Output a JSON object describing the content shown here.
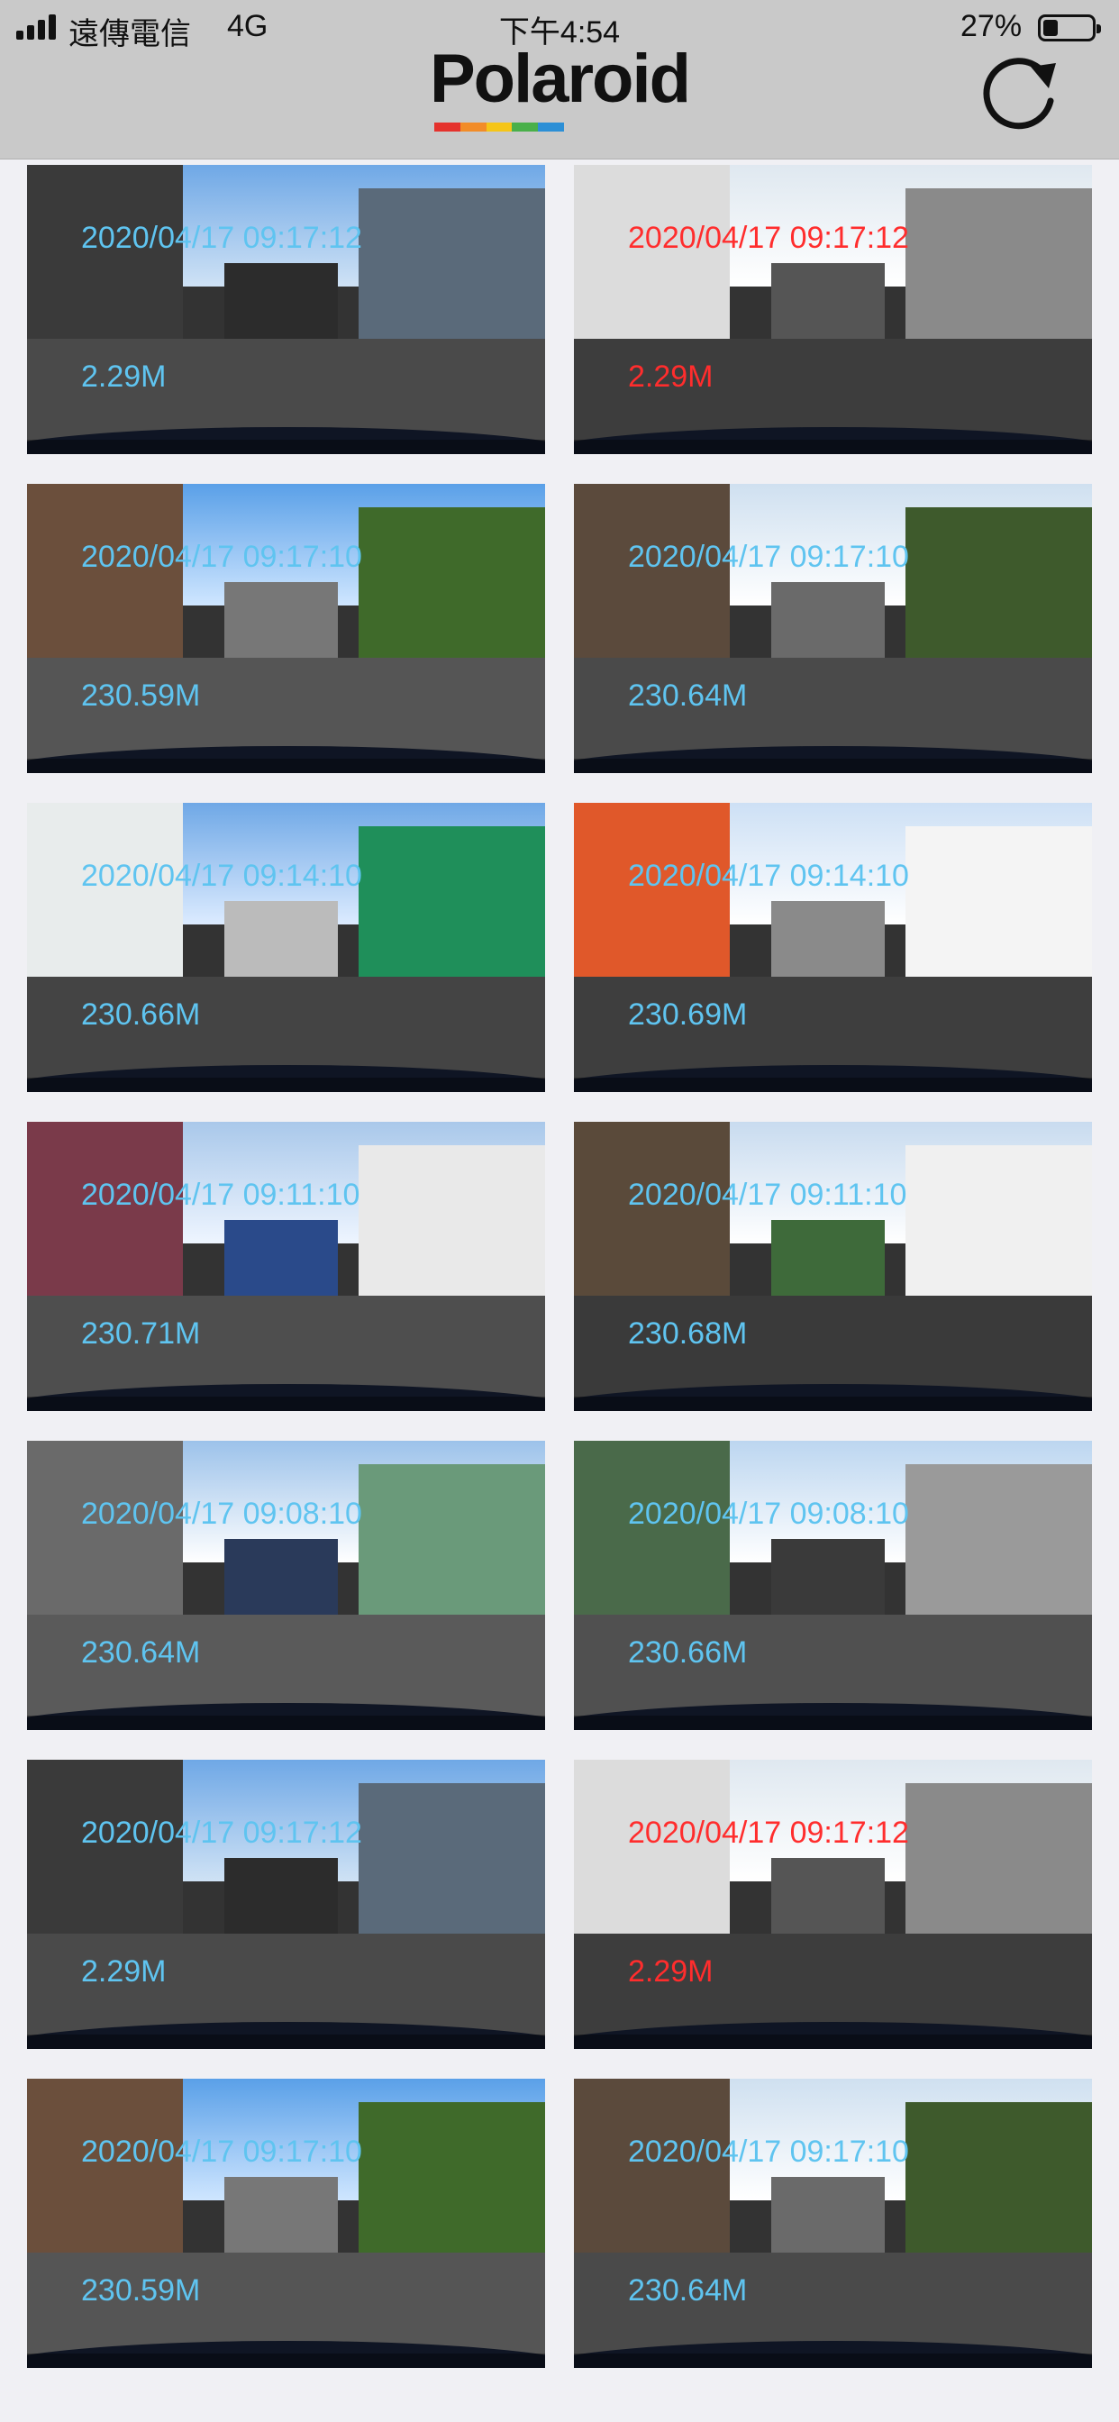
{
  "status_bar": {
    "carrier": "遠傳電信",
    "network": "4G",
    "time": "下午4:54",
    "battery": "27%"
  },
  "header": {
    "brand": "Polaroid",
    "stripe_colors": [
      "#e5322d",
      "#f28c28",
      "#f5c518",
      "#49b04a",
      "#2c8fd6"
    ],
    "refresh_icon": "refresh-icon"
  },
  "colors": {
    "header_bg": "#c9c9c9",
    "overlay_text_blue": "#5fc4f0",
    "overlay_text_red": "#ff2d2d",
    "page_bg": "#f0f0f4"
  },
  "videos": [
    {
      "timestamp": "2020/04/17 09:17:12",
      "size": "2.29M",
      "highlight": false
    },
    {
      "timestamp": "2020/04/17 09:17:12",
      "size": "2.29M",
      "highlight": true
    },
    {
      "timestamp": "2020/04/17 09:17:10",
      "size": "230.59M",
      "highlight": false
    },
    {
      "timestamp": "2020/04/17 09:17:10",
      "size": "230.64M",
      "highlight": false
    },
    {
      "timestamp": "2020/04/17 09:14:10",
      "size": "230.66M",
      "highlight": false
    },
    {
      "timestamp": "2020/04/17 09:14:10",
      "size": "230.69M",
      "highlight": false
    },
    {
      "timestamp": "2020/04/17 09:11:10",
      "size": "230.71M",
      "highlight": false
    },
    {
      "timestamp": "2020/04/17 09:11:10",
      "size": "230.68M",
      "highlight": false
    },
    {
      "timestamp": "2020/04/17 09:08:10",
      "size": "230.64M",
      "highlight": false
    },
    {
      "timestamp": "2020/04/17 09:08:10",
      "size": "230.66M",
      "highlight": false
    },
    {
      "timestamp": "2020/04/17 09:17:12",
      "size": "2.29M",
      "highlight": false
    },
    {
      "timestamp": "2020/04/17 09:17:12",
      "size": "2.29M",
      "highlight": true
    },
    {
      "timestamp": "2020/04/17 09:17:10",
      "size": "230.59M",
      "highlight": false
    },
    {
      "timestamp": "2020/04/17 09:17:10",
      "size": "230.64M",
      "highlight": false
    }
  ]
}
